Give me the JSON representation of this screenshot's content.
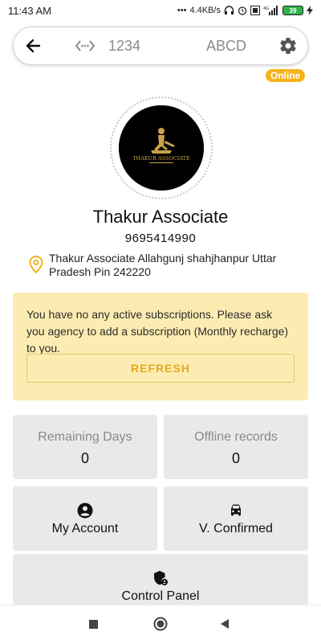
{
  "status_bar": {
    "time": "11:43 AM",
    "network_speed": "4.4KB/s",
    "battery": "39",
    "icons": [
      "headphones-icon",
      "alarm-icon",
      "volte-icon",
      "signal-icon",
      "battery-icon",
      "charging-icon"
    ]
  },
  "header": {
    "device_id": "1234",
    "device_code": "ABCD",
    "status_badge": "Online",
    "icons": [
      "back-arrow-icon",
      "device-code-icon",
      "gear-icon"
    ]
  },
  "profile": {
    "logo_text": "THAKUR ASSOCIATE",
    "name": "Thakur Associate",
    "phone": "9695414990",
    "address": "Thakur Associate Allahgunj shahjhanpur Uttar Pradesh Pin 242220"
  },
  "subscription": {
    "message": "You have no any active subscriptions. Please ask you agency to add a subscription (Monthly recharge) to you.",
    "refresh_label": "REFRESH"
  },
  "stats": {
    "remaining_days_label": "Remaining Days",
    "remaining_days_value": "0",
    "offline_records_label": "Offline records",
    "offline_records_value": "0"
  },
  "actions": {
    "my_account": "My Account",
    "v_confirmed": "V. Confirmed",
    "control_panel": "Control Panel"
  },
  "colors": {
    "accent": "#f7b21b",
    "notice_bg": "#fdecb2",
    "tile_bg": "#e9e9e9"
  }
}
